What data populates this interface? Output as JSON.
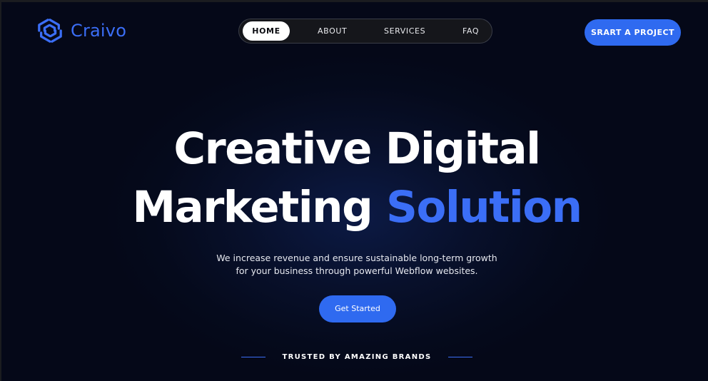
{
  "brand": {
    "name": "Craivo",
    "logo_icon": "hexagon-swirl-logo-icon",
    "accent_color": "#3b6ef6"
  },
  "nav": {
    "items": [
      {
        "label": "HOME",
        "active": true
      },
      {
        "label": "ABOUT",
        "active": false
      },
      {
        "label": "SERVICES",
        "active": false
      },
      {
        "label": "FAQ",
        "active": false
      }
    ]
  },
  "header_cta": {
    "label": "SRART A PROJECT",
    "color": "#2f6af0"
  },
  "hero": {
    "title_line1": "Creative Digital",
    "title_line2_white": "Marketing",
    "title_line2_accent": "Solution",
    "subtitle_line1": "We increase revenue and ensure sustainable long-term growth",
    "subtitle_line2": "for your business through powerful Webflow websites.",
    "button_label": "Get Started"
  },
  "trusted": {
    "label": "TRUSTED BY AMAZING BRANDS"
  },
  "colors": {
    "background": "#050a1c",
    "text": "#ffffff"
  }
}
